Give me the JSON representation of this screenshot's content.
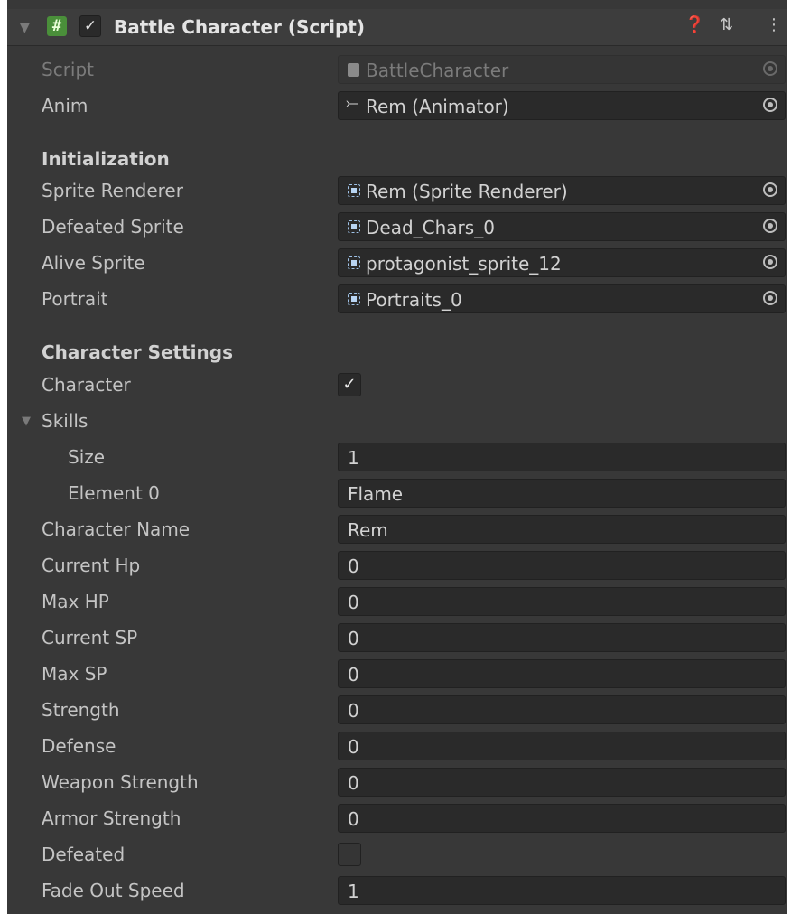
{
  "component": {
    "title": "Battle Character (Script)",
    "enabled": true,
    "icons": [
      "help-icon",
      "presets-icon",
      "kebab-menu-icon"
    ]
  },
  "fields": {
    "script": {
      "label": "Script",
      "value": "BattleCharacter"
    },
    "anim": {
      "label": "Anim",
      "value": "Rem (Animator)"
    }
  },
  "initialization": {
    "header": "Initialization",
    "sprite_renderer": {
      "label": "Sprite Renderer",
      "value": "Rem (Sprite Renderer)"
    },
    "defeated_sprite": {
      "label": "Defeated Sprite",
      "value": "Dead_Chars_0"
    },
    "alive_sprite": {
      "label": "Alive Sprite",
      "value": "protagonist_sprite_12"
    },
    "portrait": {
      "label": "Portrait",
      "value": "Portraits_0"
    }
  },
  "character_settings": {
    "header": "Character Settings",
    "character": {
      "label": "Character",
      "checked": true
    },
    "skills": {
      "label": "Skills",
      "size": {
        "label": "Size",
        "value": "1"
      },
      "element0": {
        "label": "Element 0",
        "value": "Flame"
      }
    },
    "character_name": {
      "label": "Character Name",
      "value": "Rem"
    },
    "current_hp": {
      "label": "Current Hp",
      "value": "0"
    },
    "max_hp": {
      "label": "Max HP",
      "value": "0"
    },
    "current_sp": {
      "label": "Current SP",
      "value": "0"
    },
    "max_sp": {
      "label": "Max SP",
      "value": "0"
    },
    "strength": {
      "label": "Strength",
      "value": "0"
    },
    "defense": {
      "label": "Defense",
      "value": "0"
    },
    "weapon_strength": {
      "label": "Weapon Strength",
      "value": "0"
    },
    "armor_strength": {
      "label": "Armor Strength",
      "value": "0"
    },
    "defeated": {
      "label": "Defeated",
      "checked": false
    },
    "fade_out_speed": {
      "label": "Fade Out Speed",
      "value": "1"
    }
  },
  "colors": {
    "background": "#383838",
    "field_bg": "#2a2a2a",
    "script_icon": "#4a8f3a",
    "text": "#c4c4c4"
  }
}
